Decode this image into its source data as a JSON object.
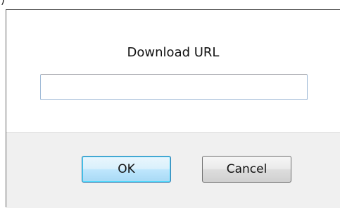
{
  "window": {
    "title_fragment": ")"
  },
  "dialog": {
    "label": "Download URL",
    "url_input": {
      "value": "",
      "placeholder": ""
    },
    "buttons": {
      "ok_label": "OK",
      "cancel_label": "Cancel"
    }
  },
  "colors": {
    "dialog_border": "#646464",
    "footer_background": "#f0f0f0",
    "input_border": "#9fbad7",
    "default_button_border": "#3c7fb1"
  }
}
